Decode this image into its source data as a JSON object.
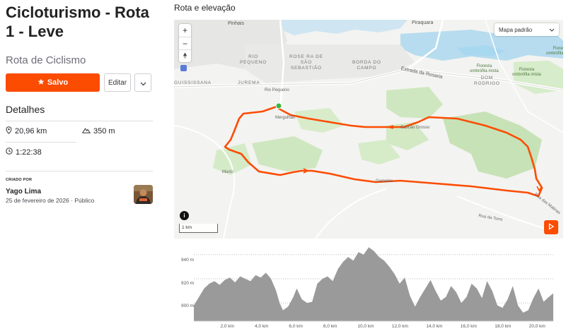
{
  "route": {
    "title": "Cicloturismo - Rota 1 - Leve",
    "type": "Rota de Ciclismo",
    "save_label": "Salvo",
    "edit_label": "Editar"
  },
  "details": {
    "title": "Detalhes",
    "distance": "20,96 km",
    "elevation_gain": "350 m",
    "time": "1:22:38"
  },
  "creator": {
    "label": "CRIADO POR",
    "name": "Yago Lima",
    "date": "25 de fevereiro de 2026",
    "visibility": "Público"
  },
  "map": {
    "section_title": "Rota e elevação",
    "style_label": "Mapa padrão",
    "scale_label": "1 km",
    "info_label": "i",
    "labels": {
      "pinhais": "Pinhais",
      "piraquara": "Piraquara",
      "rio_pequeno_area": "RIO\nPEQUENO",
      "bairro_rosa": "ROSE RA DE\nSÃO\nSEBASTIÃO",
      "borda_campo": "BORDA DO\nCAMPO",
      "guississana": "GUISSISSANA",
      "jurema": "JUREMA",
      "rio_pequeno": "Rio Pequeno",
      "estrada_rosaria": "Estrada da Rosaria",
      "merguhao": "Mergulhão",
      "cascao_grosso": "Cascão Grosso",
      "florestas": "Floresta\nombrófila mista",
      "floresta2": "Floresta\nombrófila mista",
      "floresta3": "Floresta\nombrófila mista",
      "dom_rodrigo": "DOM\nRODRIGO",
      "murici": "Murici",
      "gamelas": "Gamelas",
      "rua_torre": "Rua da Torre",
      "rua_malinas": "Rua das Malinas"
    }
  },
  "elevation": {
    "y_ticks": [
      "940 m",
      "920 m",
      "900 m"
    ],
    "x_ticks": [
      "2,0 km",
      "4,0 km",
      "6,0 km",
      "8,0 km",
      "10,0 km",
      "12,0 km",
      "14,0 km",
      "16,0 km",
      "18,0 km",
      "20,0 km"
    ]
  },
  "chart_data": {
    "type": "area",
    "xlabel": "",
    "ylabel": "",
    "x_unit": "km",
    "y_unit": "m",
    "ylim": [
      885,
      948
    ],
    "xlim": [
      0,
      20.96
    ],
    "x": [
      0,
      0.3,
      0.6,
      0.9,
      1.2,
      1.5,
      1.8,
      2.1,
      2.4,
      2.7,
      3.0,
      3.3,
      3.6,
      3.9,
      4.2,
      4.5,
      4.8,
      5.0,
      5.2,
      5.5,
      5.8,
      6.0,
      6.3,
      6.6,
      6.9,
      7.2,
      7.5,
      7.8,
      8.1,
      8.4,
      8.7,
      9.0,
      9.3,
      9.6,
      9.9,
      10.2,
      10.5,
      10.8,
      11.1,
      11.4,
      11.7,
      12.0,
      12.3,
      12.6,
      12.9,
      13.2,
      13.5,
      13.8,
      14.1,
      14.4,
      14.7,
      15.0,
      15.3,
      15.6,
      15.9,
      16.2,
      16.5,
      16.8,
      17.1,
      17.4,
      17.7,
      18.0,
      18.3,
      18.6,
      18.9,
      19.2,
      19.5,
      19.8,
      20.1,
      20.4,
      20.7,
      20.96
    ],
    "series": [
      {
        "values": [
          898,
          905,
          912,
          916,
          918,
          915,
          919,
          921,
          917,
          922,
          920,
          918,
          923,
          921,
          925,
          920,
          910,
          900,
          894,
          897,
          905,
          912,
          903,
          900,
          901,
          916,
          920,
          922,
          918,
          928,
          934,
          938,
          935,
          942,
          940,
          946,
          943,
          938,
          935,
          930,
          924,
          916,
          921,
          906,
          897,
          905,
          912,
          919,
          910,
          902,
          905,
          914,
          909,
          900,
          905,
          916,
          912,
          904,
          918,
          910,
          898,
          896,
          903,
          914,
          898,
          892,
          894,
          904,
          912,
          901,
          905,
          908
        ]
      }
    ],
    "grid": true,
    "fill_color": "#9a9a9a"
  },
  "colors": {
    "accent": "#fc4c02",
    "route": "#fc4c02",
    "start_marker": "#3cb53c",
    "park_green": "#cfe7c0",
    "water": "#a8d8f0"
  }
}
